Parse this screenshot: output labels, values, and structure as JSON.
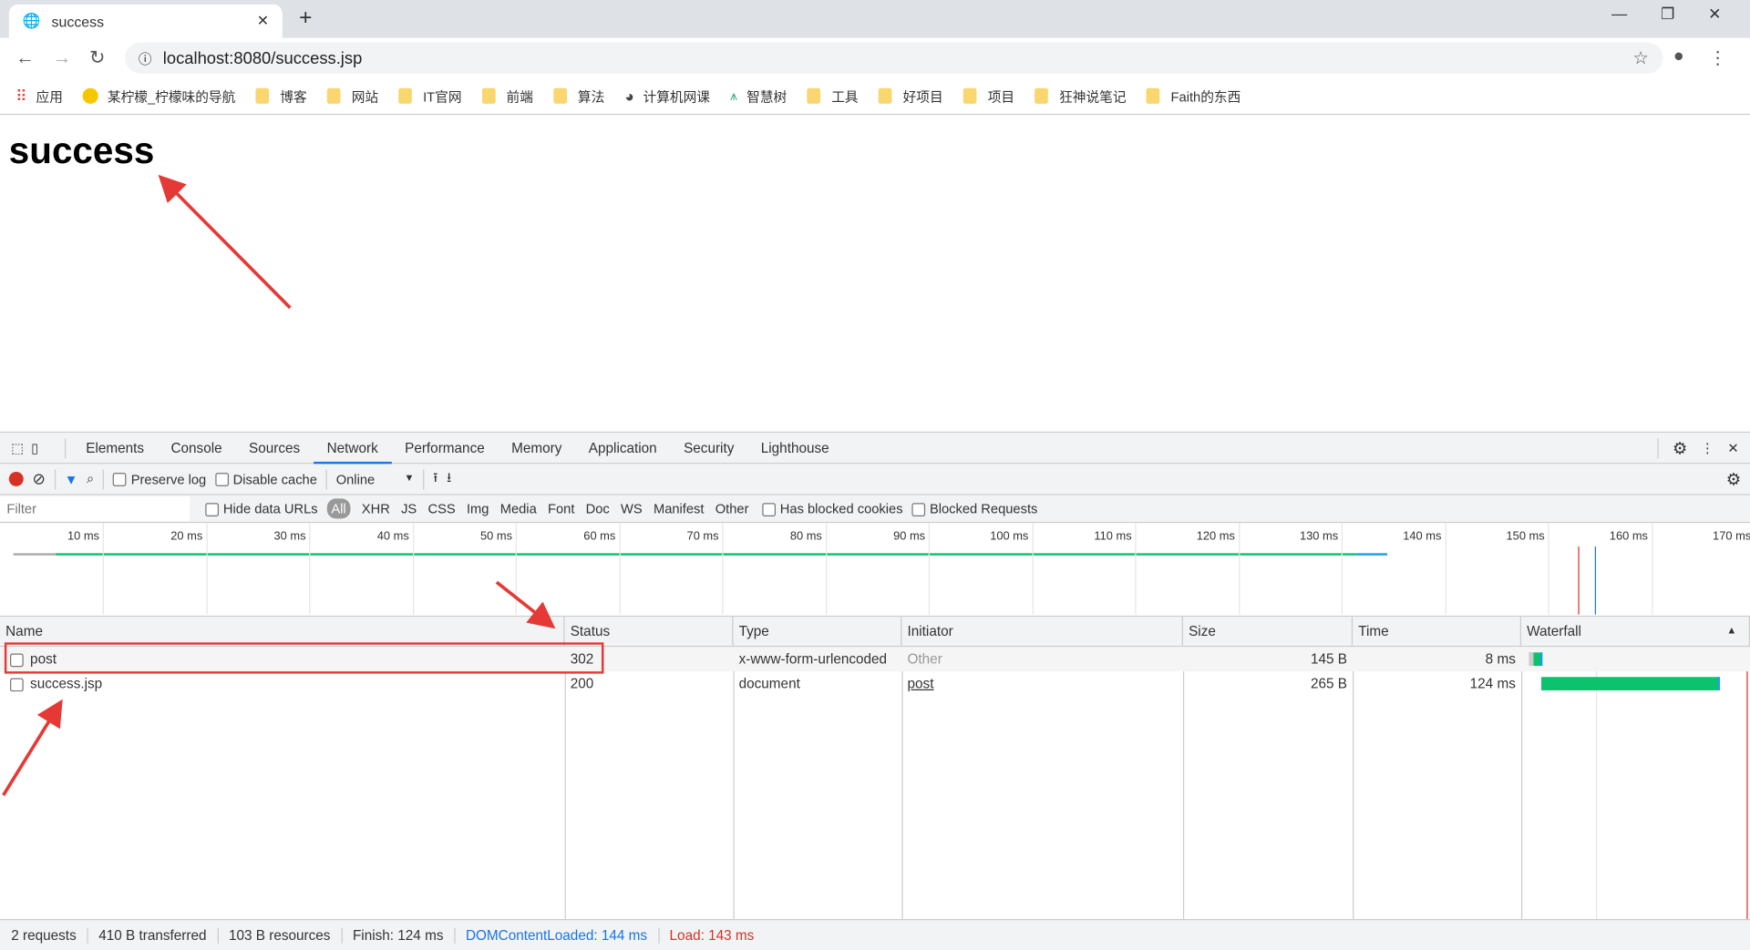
{
  "browser": {
    "tab_title": "success",
    "url": "localhost:8080/success.jsp",
    "bookmarks": [
      "应用",
      "某柠檬_柠檬味的导航",
      "博客",
      "网站",
      "IT官网",
      "前端",
      "算法",
      "计算机网课",
      "智慧树",
      "工具",
      "好项目",
      "项目",
      "狂神说笔记",
      "Faith的东西"
    ]
  },
  "page": {
    "heading": "success"
  },
  "devtools": {
    "tabs": [
      "Elements",
      "Console",
      "Sources",
      "Network",
      "Performance",
      "Memory",
      "Application",
      "Security",
      "Lighthouse"
    ],
    "active_tab": "Network",
    "toolbar": {
      "preserve_log": "Preserve log",
      "disable_cache": "Disable cache",
      "throttle": "Online"
    },
    "filter": {
      "placeholder": "Filter",
      "hide_data_urls": "Hide data URLs",
      "types": [
        "All",
        "XHR",
        "JS",
        "CSS",
        "Img",
        "Media",
        "Font",
        "Doc",
        "WS",
        "Manifest",
        "Other"
      ],
      "has_blocked_cookies": "Has blocked cookies",
      "blocked_requests": "Blocked Requests"
    },
    "timeline_ticks": [
      "10 ms",
      "20 ms",
      "30 ms",
      "40 ms",
      "50 ms",
      "60 ms",
      "70 ms",
      "80 ms",
      "90 ms",
      "100 ms",
      "110 ms",
      "120 ms",
      "130 ms",
      "140 ms",
      "150 ms",
      "160 ms",
      "170 ms"
    ],
    "columns": [
      "Name",
      "Status",
      "Type",
      "Initiator",
      "Size",
      "Time",
      "Waterfall"
    ],
    "rows": [
      {
        "name": "post",
        "status": "302",
        "type": "x-www-form-urlencoded",
        "initiator": "Other",
        "size": "145 B",
        "time": "8 ms"
      },
      {
        "name": "success.jsp",
        "status": "200",
        "type": "document",
        "initiator": "post",
        "size": "265 B",
        "time": "124 ms"
      }
    ],
    "statusbar": {
      "requests": "2 requests",
      "transferred": "410 B transferred",
      "resources": "103 B resources",
      "finish": "Finish: 124 ms",
      "dcl": "DOMContentLoaded: 144 ms",
      "load": "Load: 143 ms"
    },
    "colors": {
      "accent": "#1a73e8",
      "dcl": "#1a73e8",
      "load": "#d93025",
      "waterfall": "#0cc26d",
      "annotation": "#e53935"
    }
  }
}
